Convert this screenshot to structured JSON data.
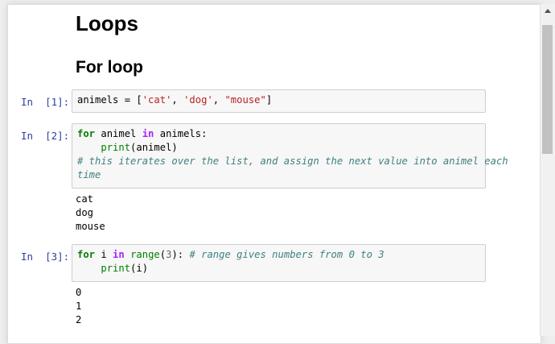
{
  "headings": {
    "h1": "Loops",
    "h2": "For loop"
  },
  "cells": [
    {
      "prompt": "In  [1]:",
      "code": [
        [
          {
            "t": "animels = [",
            "c": ""
          },
          {
            "t": "'cat'",
            "c": "str"
          },
          {
            "t": ", ",
            "c": ""
          },
          {
            "t": "'dog'",
            "c": "str"
          },
          {
            "t": ", ",
            "c": ""
          },
          {
            "t": "\"mouse\"",
            "c": "str"
          },
          {
            "t": "]",
            "c": ""
          }
        ]
      ],
      "output": []
    },
    {
      "prompt": "In  [2]:",
      "code": [
        [
          {
            "t": "for",
            "c": "kw"
          },
          {
            "t": " animel ",
            "c": ""
          },
          {
            "t": "in",
            "c": "op"
          },
          {
            "t": " animels:",
            "c": ""
          }
        ],
        [
          {
            "t": "    ",
            "c": ""
          },
          {
            "t": "print",
            "c": "bi"
          },
          {
            "t": "(animel)",
            "c": ""
          }
        ],
        [
          {
            "t": "# this iterates over the list, and assign the next value into animel each",
            "c": "cm"
          }
        ],
        [
          {
            "t": "time",
            "c": "cm"
          }
        ]
      ],
      "output": [
        "cat",
        "dog",
        "mouse"
      ]
    },
    {
      "prompt": "In  [3]:",
      "code": [
        [
          {
            "t": "for",
            "c": "kw"
          },
          {
            "t": " i ",
            "c": ""
          },
          {
            "t": "in",
            "c": "op"
          },
          {
            "t": " ",
            "c": ""
          },
          {
            "t": "range",
            "c": "bi"
          },
          {
            "t": "(",
            "c": ""
          },
          {
            "t": "3",
            "c": "num"
          },
          {
            "t": "): ",
            "c": ""
          },
          {
            "t": "# range gives numbers from 0 to 3",
            "c": "cm"
          }
        ],
        [
          {
            "t": "    ",
            "c": ""
          },
          {
            "t": "print",
            "c": "bi"
          },
          {
            "t": "(i)",
            "c": ""
          }
        ]
      ],
      "output": [
        "0",
        "1",
        "2"
      ]
    }
  ]
}
